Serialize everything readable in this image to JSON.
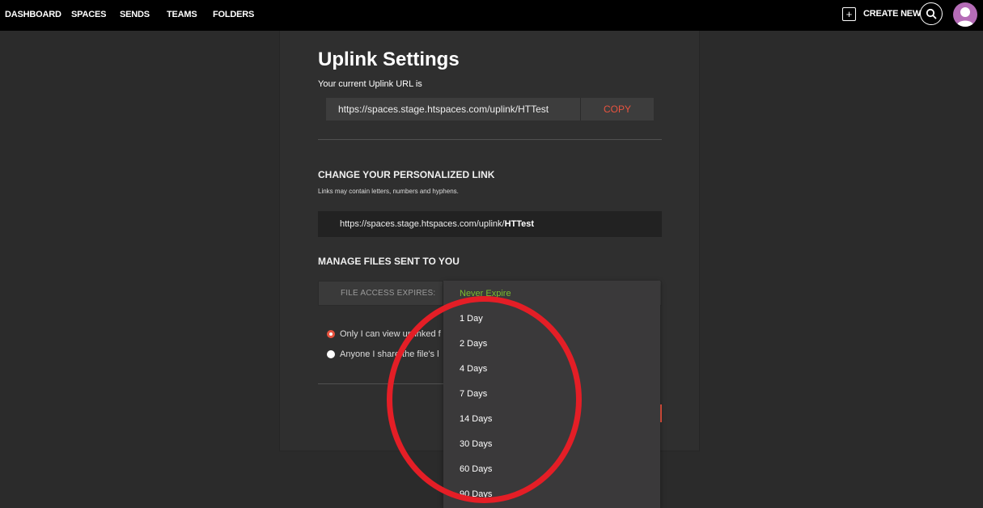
{
  "nav": {
    "items": [
      "DASHBOARD",
      "SPACES",
      "SENDS",
      "TEAMS",
      "FOLDERS"
    ],
    "create_new": "CREATE NEW"
  },
  "page": {
    "title": "Uplink Settings",
    "current_url_label": "Your current Uplink URL is",
    "current_url": "https://spaces.stage.htspaces.com/uplink/HTTest",
    "copy_label": "COPY"
  },
  "personalized": {
    "heading": "CHANGE YOUR PERSONALIZED LINK",
    "hint": "Links may contain letters, numbers and hyphens.",
    "url_prefix": "https://spaces.stage.htspaces.com/uplink/",
    "url_slug": "HTTest"
  },
  "manage": {
    "heading": "MANAGE FILES SENT TO YOU",
    "expires_label": "FILE ACCESS EXPIRES:",
    "radio_options": [
      {
        "label": "Only I can view unlinked f",
        "checked": true
      },
      {
        "label": "Anyone I share the file's l",
        "checked": false
      }
    ]
  },
  "dropdown": {
    "options": [
      "Never Expire",
      "1 Day",
      "2 Days",
      "4 Days",
      "7 Days",
      "14 Days",
      "30 Days",
      "60 Days",
      "90 Days"
    ],
    "selected": "Never Expire"
  },
  "colors": {
    "accent": "#e8533f",
    "selected_option": "#7cbd2e",
    "annotation": "#e41e26"
  }
}
